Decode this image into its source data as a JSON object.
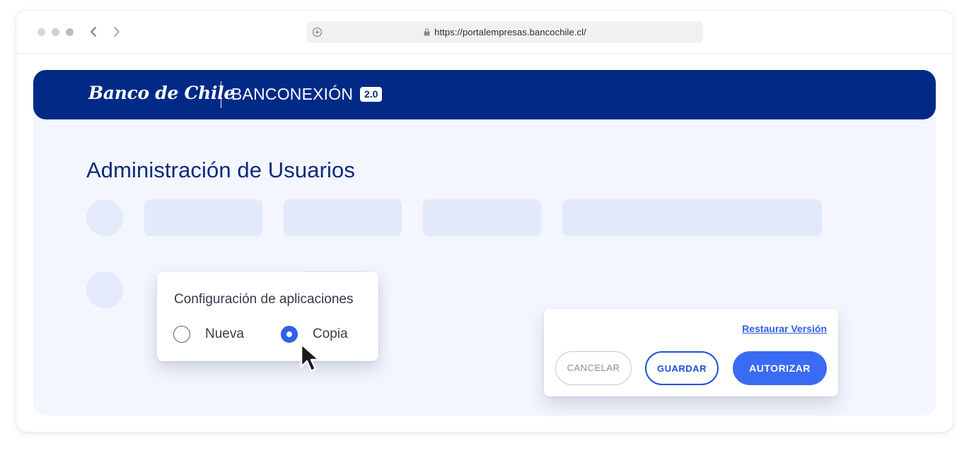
{
  "browser": {
    "url": "https://portalempresas.bancochile.cl/"
  },
  "banner": {
    "logo": "Banco de Chile",
    "product": "BANCONEXIÓN",
    "version": "2.0"
  },
  "page": {
    "title": "Administración de Usuarios"
  },
  "popover": {
    "title": "Configuración de aplicaciones",
    "options": [
      {
        "label": "Nueva",
        "selected": false
      },
      {
        "label": "Copia",
        "selected": true
      }
    ]
  },
  "actions": {
    "restore_link": "Restaurar Versión",
    "cancel": "CANCELAR",
    "save": "GUARDAR",
    "authorize": "AUTORIZAR"
  },
  "colors": {
    "brand_navy": "#002a86",
    "accent_blue": "#3b6bf2",
    "content_bg": "#f3f6fe",
    "skeleton": "#e1e9fb"
  },
  "icons": [
    "new-tab-icon",
    "lock-icon",
    "back-arrow-icon",
    "forward-arrow-icon",
    "mouse-cursor-icon"
  ]
}
